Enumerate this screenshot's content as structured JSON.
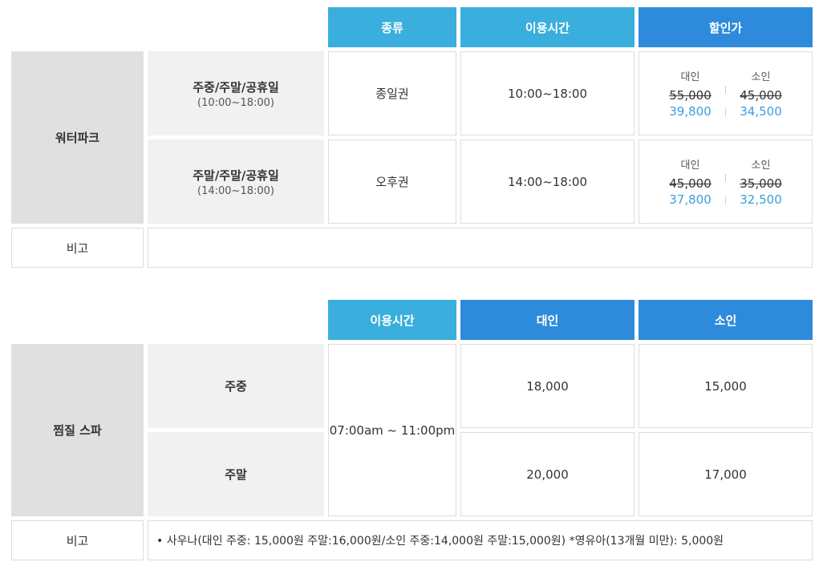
{
  "water": {
    "headers": {
      "type": "종류",
      "time": "이용시간",
      "discount": "할인가"
    },
    "category": "워터파크",
    "rows": [
      {
        "days": "주중/주말/공휴일",
        "hours": "(10:00~18:00)",
        "ticket": "종일권",
        "time": "10:00~18:00",
        "adult_label": "대인",
        "child_label": "소인",
        "adult_old": "55,000",
        "adult_new": "39,800",
        "child_old": "45,000",
        "child_new": "34,500"
      },
      {
        "days": "주말/주말/공휴일",
        "hours": "(14:00~18:00)",
        "ticket": "오후권",
        "time": "14:00~18:00",
        "adult_label": "대인",
        "child_label": "소인",
        "adult_old": "45,000",
        "adult_new": "37,800",
        "child_old": "35,000",
        "child_new": "32,500"
      }
    ],
    "note_label": "비고",
    "note_text": ""
  },
  "spa": {
    "headers": {
      "time": "이용시간",
      "adult": "대인",
      "child": "소인"
    },
    "category": "찜질 스파",
    "time": "07:00am ~ 11:00pm",
    "rows": [
      {
        "day": "주중",
        "adult": "18,000",
        "child": "15,000"
      },
      {
        "day": "주말",
        "adult": "20,000",
        "child": "17,000"
      }
    ],
    "note_label": "비고",
    "note_text": "•  사우나(대인 주중: 15,000원 주말:16,000원/소인 주중:14,000원 주말:15,000원) *영유아(13개월 미만): 5,000원"
  },
  "colors": {
    "header_cyan": "#3aaedc",
    "header_blue": "#2e8bdc",
    "discount_price": "#3a9ee0"
  }
}
